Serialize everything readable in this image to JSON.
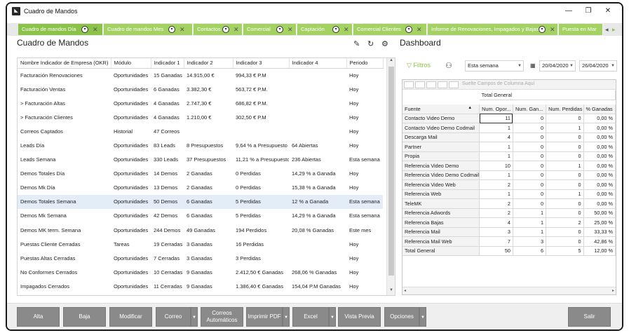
{
  "window": {
    "title": "Cuadro de Mandos",
    "minimize": "—",
    "restore": "❐",
    "close": "✕"
  },
  "tabs": [
    {
      "label": "Cuadro de mandos Día",
      "active": true
    },
    {
      "label": "Cuadro de mandos Mes",
      "active": false
    },
    {
      "label": "Contactos",
      "active": false
    },
    {
      "label": "Comercial",
      "active": false
    },
    {
      "label": "Captación",
      "active": false
    },
    {
      "label": "Comercial Clientes",
      "active": false
    },
    {
      "label": "Informe de Renovaciones, Impagados y Bajas",
      "active": false
    },
    {
      "label": "Puesta en Mar",
      "active": false
    }
  ],
  "left": {
    "title": "Cuadro de Mandos",
    "columns": [
      "Nombre Indicador de Empresa (OKR)",
      "Módulo",
      "Indicador 1",
      "Indicador 2",
      "Indicador 3",
      "Indicador 4",
      "Periodo"
    ],
    "rows": [
      [
        "Facturación Renovaciones",
        "Oportunidades",
        "15 Ganadas",
        "14.915,00 €",
        "994,33 € P.M",
        "",
        "Hoy"
      ],
      [
        "Facturación Ventas",
        "Oportunidades",
        "6 Ganadas",
        "3.382,30 €",
        "563,72 € P.M.",
        "",
        "Hoy"
      ],
      [
        "> Facturación Altas",
        "Oportunidades",
        "4 Ganadas",
        "2.747,30 €",
        "686,82 € P.M.",
        "",
        "Hoy"
      ],
      [
        "> Facturación Clientes",
        "Oportunidades",
        "4 Ganadas",
        "1.210,00 €",
        "302,50 € P.M",
        "",
        "Hoy"
      ],
      [
        "Correos Captados",
        "Historial",
        "47 Correos",
        "",
        "",
        "",
        "Hoy"
      ],
      [
        "Leads Día",
        "Oportunidades",
        "83 Leads",
        "8 Presupuestos",
        "9,64 % a Presupuesto",
        "64 Abiertas",
        "Hoy"
      ],
      [
        "Leads Semana",
        "Oportunidades",
        "330 Leads",
        "37 Presupuestos",
        "11,21 % a Presupuesto",
        "236 Abiertas",
        "Esta semana"
      ],
      [
        "Demos Totales Día",
        "Oportunidades",
        "14 Demos",
        "2 Ganadas",
        "0 Perdidas",
        "14,29 %  a Ganada",
        "Hoy"
      ],
      [
        "Demos Mk Día",
        "Oportunidades",
        "13 Demos",
        "2 Ganadas",
        "0 Perdidas",
        "15,38 %  a Ganada",
        "Hoy"
      ],
      [
        "Demos Totales Semana",
        "Oportunidades",
        "50 Demos",
        "6 Ganadas",
        "5 Perdidas",
        "12 %  a Ganada",
        "Esta semana"
      ],
      [
        "Demos Mk Semana",
        "Oportunidades",
        "42 Demos",
        "6 Ganadas",
        "5 Perdidas",
        "14,29 %  a Ganada",
        "Esta semana"
      ],
      [
        "Demos MK term. Semana",
        "Oportunidades",
        "244 Demos",
        "49 Ganadas",
        "194 Perdidos",
        "20,08 % Ganadas",
        "Este mes"
      ],
      [
        "Puestas Cliente Cerradas",
        "Tareas",
        "19 Cerradas",
        "3 Ganadas",
        "16 Perdidas",
        "",
        "Hoy"
      ],
      [
        "Puestas Altas Cerradas",
        "Oportunidades",
        "7 Cerradas",
        "3 Ganadas",
        "3 Perdidas",
        "",
        "Hoy"
      ],
      [
        "No Conformes Cerrados",
        "Oportunidades",
        "10 Cerradas",
        "9 Ganadas",
        "2.412,50 € Ganadas",
        "268,06 % Ganadas",
        "Hoy"
      ],
      [
        "Impagados Cerrados",
        "Oportunidades",
        "11 Cerradas",
        "9 Ganadas",
        "1.386,40 € Ganadas",
        "154,04 P.M Ganadas",
        "Hoy"
      ]
    ],
    "selected_row": 9,
    "icons": [
      "edit-chart-icon",
      "refresh-icon",
      "settings-icon"
    ]
  },
  "right": {
    "title": "Dashboard",
    "filters_label": "Filtros",
    "period_select": "Esta semana",
    "date_from": "20/04/2020",
    "date_to": "26/04/2020",
    "drop_hint": "Suelte Campos de Columna Aquí",
    "total_general": "Total General",
    "pivot_columns": [
      "Fuente",
      "Num. Opor...",
      "Num. Gan...",
      "Num. Perdidas",
      "% Ganadas"
    ],
    "pivot_rows": [
      [
        "Contacto Video Demo",
        "11",
        "0",
        "0",
        "0,00 %"
      ],
      [
        "Contacto Video Demo Codmail",
        "1",
        "0",
        "1",
        "0,00 %"
      ],
      [
        "Descarga Mail",
        "4",
        "0",
        "0",
        "0,00 %"
      ],
      [
        "Partner",
        "1",
        "0",
        "0",
        "0,00 %"
      ],
      [
        "Propia",
        "1",
        "0",
        "0",
        "0,00 %"
      ],
      [
        "Referencia Video Demo",
        "10",
        "0",
        "1",
        "0,00 %"
      ],
      [
        "Referencia Video Demo Codmail",
        "1",
        "0",
        "0",
        "0,00 %"
      ],
      [
        "Referencia Video Web",
        "2",
        "0",
        "0",
        "0,00 %"
      ],
      [
        "Referencia Web",
        "1",
        "0",
        "1",
        "0,00 %"
      ],
      [
        "TeleMK",
        "2",
        "0",
        "0",
        "0,00 %"
      ],
      [
        "Referencia Adwords",
        "2",
        "1",
        "0",
        "50,00 %"
      ],
      [
        "Referencia Bajas",
        "4",
        "1",
        "2",
        "25,00 %"
      ],
      [
        "Referencia Mail",
        "3",
        "1",
        "0",
        "33,33 %"
      ],
      [
        "Referencia Mail Web",
        "7",
        "3",
        "0",
        "42,86 %"
      ],
      [
        "Total General",
        "50",
        "6",
        "5",
        "12,00 %"
      ]
    ]
  },
  "toolbar": {
    "alta": "Alta",
    "baja": "Baja",
    "modificar": "Modificar",
    "correo": "Correo",
    "correos_auto_1": "Correos",
    "correos_auto_2": "Automáticos",
    "imprimir": "Imprimir PDF",
    "excel": "Excel",
    "vista_previa": "Vista Previa",
    "opciones": "Opciones",
    "salir": "Salir"
  },
  "colors": {
    "accent": "#8bc34a",
    "tab_inactive": "#a3d162",
    "button": "#8a8a8a",
    "selected_row": "#e4ecf7"
  }
}
